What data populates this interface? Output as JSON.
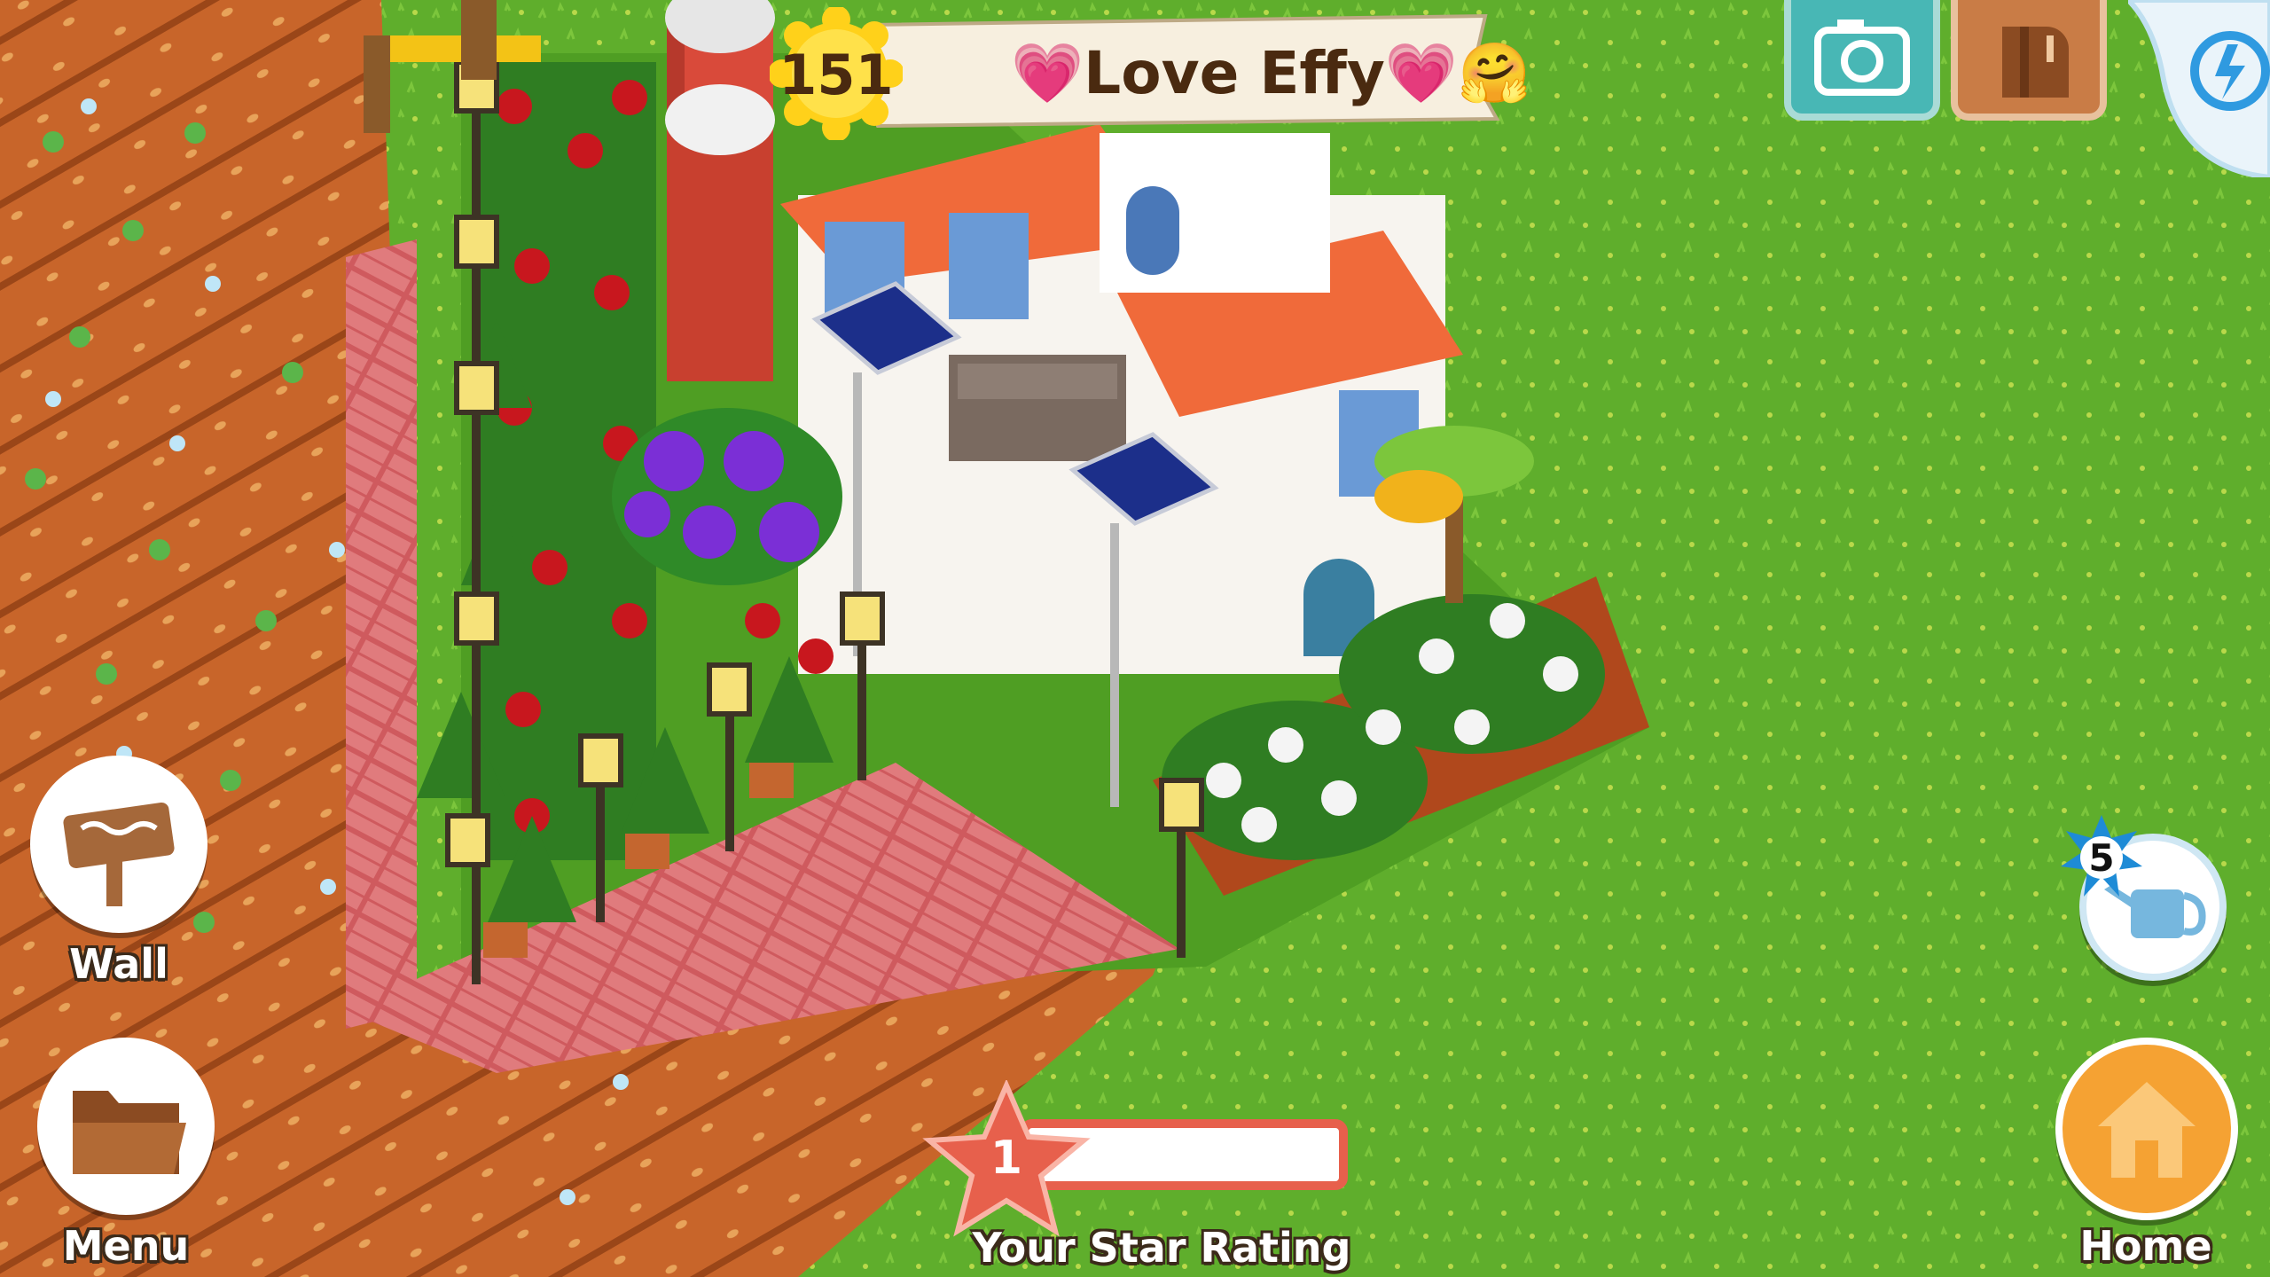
{
  "player": {
    "level": "151",
    "name": "💗Love Effy💗🤗"
  },
  "buttons": {
    "wall_label": "Wall",
    "menu_label": "Menu",
    "home_label": "Home",
    "camera": "camera-icon",
    "mail": "mailbox-icon",
    "energy": "lightning-icon"
  },
  "watering_can": {
    "count": "5"
  },
  "star_rating": {
    "value": "1",
    "label": "Your Star Rating",
    "progress": 0
  },
  "colors": {
    "grass": "#5fae2c",
    "soil": "#c8652a",
    "roof": "#f06a3a",
    "brick_path": "#d9676a",
    "accent_star": "#e7604c",
    "home_button": "#f5a233"
  }
}
